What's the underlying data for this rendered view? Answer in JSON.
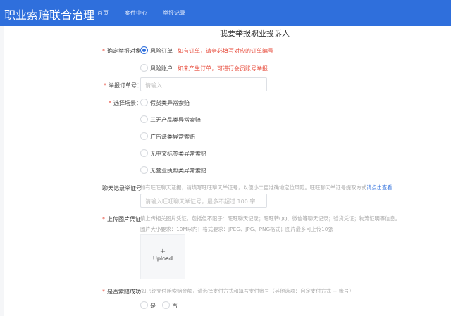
{
  "header": {
    "logo": "职业索赔联合治理",
    "nav": [
      "首页",
      "案件中心",
      "举报记录"
    ]
  },
  "form": {
    "title": "我要举报职业投诉人",
    "target": {
      "label": "确定举报对象",
      "options": [
        {
          "label": "风险订单",
          "hint": "如有订单，请务必填写对应的订单编号",
          "selected": true
        },
        {
          "label": "风险账户",
          "hint": "如未产生订单，可进行会员账号举报",
          "selected": false
        }
      ]
    },
    "order": {
      "label": "举报订单号：",
      "placeholder": "请输入"
    },
    "scene": {
      "label": "选择场景：",
      "options": [
        "假货类异常索赔",
        "三无产品类异常索赔",
        "广告法类异常索赔",
        "无中文标签类异常索赔",
        "无营业执照类异常索赔"
      ]
    },
    "chat": {
      "label": "聊天记录举证号",
      "hint": "如有旺旺聊天证据，请填写旺旺聊天举证号，以便小二更准确地定位风险。旺旺聊天举证号提取方式",
      "link": "请点击查看",
      "placeholder": "请输入旺旺聊天举证号，最多不超过 100 字"
    },
    "upload": {
      "label": "上传图片凭证",
      "hint1": "请上传相关图片凭证，包括但不限于：旺旺聊天记录；旺旺转QQ、微信等聊天记录；验货凭证；物流证明等信息。",
      "hint2": "图片大小要求：10M以内；格式要求：JPEG、JPG、PNG格式；图片最多可上传10张",
      "plus": "+",
      "button": "Upload"
    },
    "success": {
      "label": "是否索赔成功",
      "hint": "如已经支付赔索赔金额，请选择支付方式和填写支付账号（其他选项：自定支付方式 + 账号）",
      "options": [
        "是",
        "否"
      ]
    }
  }
}
